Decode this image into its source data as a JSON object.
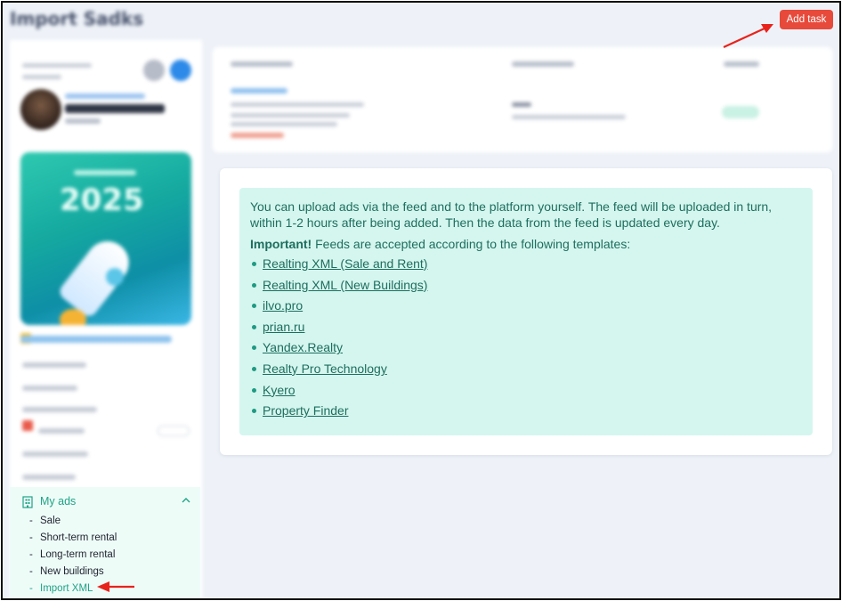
{
  "page": {
    "title": "Import Sadks"
  },
  "header": {
    "add_task_label": "Add task"
  },
  "info": {
    "intro": "You can upload ads via the feed and to the platform yourself. The feed will be uploaded in turn, within 1-2 hours after being added. Then the data from the feed is updated every day.",
    "important_label": "Important!",
    "important_text": " Feeds are accepted according to the following templates:",
    "templates": [
      "Realting XML (Sale and Rent)",
      "Realting XML (New Buildings)",
      "ilvo.pro",
      "prian.ru",
      "Yandex.Realty",
      "Realty Pro Technology",
      "Kyero",
      "Property Finder"
    ]
  },
  "sidebar": {
    "promo_year": "2025",
    "my_ads": {
      "label": "My ads",
      "items": [
        {
          "label": "Sale"
        },
        {
          "label": "Short-term rental"
        },
        {
          "label": "Long-term rental"
        },
        {
          "label": "New buildings"
        },
        {
          "label": "Import XML"
        }
      ]
    }
  },
  "colors": {
    "accent": "#1fa386",
    "add_task": "#e74a3b",
    "annotation_arrow": "#e8231b",
    "alert_bg": "#d5f6ef",
    "alert_text": "#1d6e5e"
  }
}
